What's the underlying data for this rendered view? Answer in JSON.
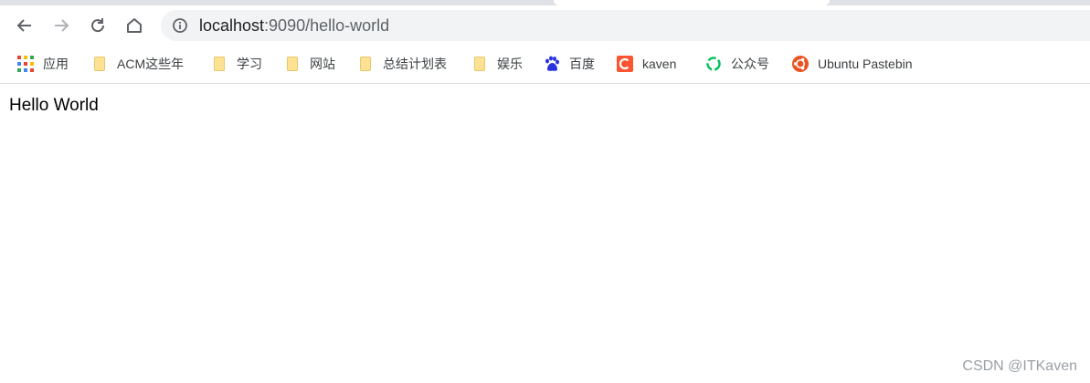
{
  "browser": {
    "url_host": "localhost",
    "url_rest": ":9090/hello-world"
  },
  "bookmarks": [
    {
      "label": "应用",
      "icon": "apps-grid-icon"
    },
    {
      "label": "ACM这些年",
      "icon": "folder-icon"
    },
    {
      "label": "学习",
      "icon": "folder-icon"
    },
    {
      "label": "网站",
      "icon": "folder-icon"
    },
    {
      "label": "总结计划表",
      "icon": "folder-icon"
    },
    {
      "label": "娱乐",
      "icon": "folder-icon"
    },
    {
      "label": "百度",
      "icon": "baidu-paw-icon"
    },
    {
      "label": "kaven",
      "icon": "csdn-c-icon"
    },
    {
      "label": "公众号",
      "icon": "wechat-channel-icon"
    },
    {
      "label": "Ubuntu Pastebin",
      "icon": "ubuntu-icon"
    }
  ],
  "page": {
    "text": "Hello World"
  },
  "watermark": "CSDN @ITKaven"
}
